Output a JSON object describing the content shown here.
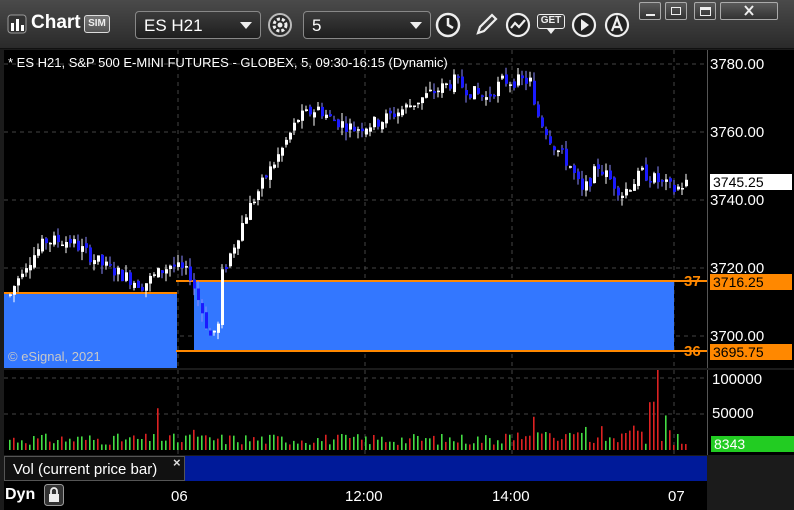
{
  "toolbar": {
    "app_title": "Chart",
    "sim_badge": "SIM",
    "symbol": "ES H21",
    "interval": "5",
    "get_label": "GET",
    "icons": [
      "gear-icon",
      "clock-icon",
      "pencil-icon",
      "chart-style-icon",
      "get-data-icon",
      "play-icon",
      "alert-icon"
    ],
    "window_buttons": [
      "minimize",
      "restore",
      "maximize",
      "close"
    ]
  },
  "chart": {
    "caption": "* ES H21, S&P 500 E-MINI FUTURES - GLOBEX, 5, 09:30-16:15 (Dynamic)",
    "copyright": "© eSignal, 2021",
    "current_price": "3745.25",
    "price_ticks": [
      "3780.00",
      "3760.00",
      "3740.00",
      "3720.00",
      "3700.00"
    ],
    "level_boxes": [
      {
        "tag": "37",
        "price": "3716.25"
      },
      {
        "tag": "36",
        "price": "3695.75"
      }
    ],
    "colors": {
      "up_candle": "#ffffff",
      "down_candle": "#1a1aff",
      "box_fill": "#3377ff",
      "box_line": "#ff8800",
      "vol_up": "#44dd44",
      "vol_down": "#dd2222"
    }
  },
  "volume": {
    "tab_label": "Vol (current price bar)",
    "close_symbol": "×",
    "ticks": [
      "100000",
      "50000"
    ],
    "current": "8343"
  },
  "time_axis": {
    "labels": [
      "06",
      "12:00",
      "14:00",
      "07"
    ],
    "mode": "Dyn"
  }
}
